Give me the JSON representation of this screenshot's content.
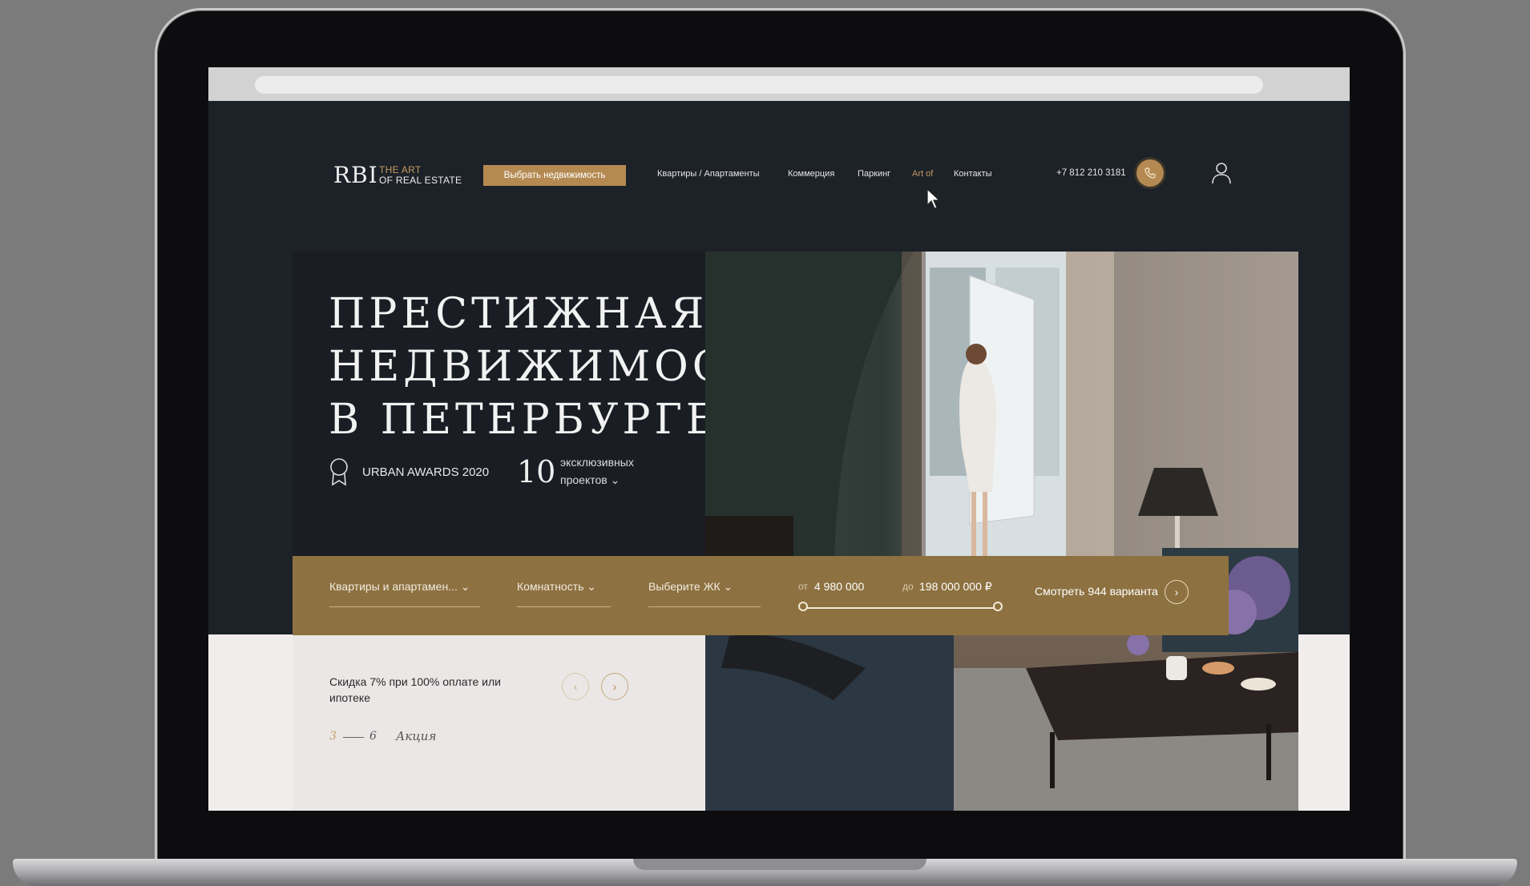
{
  "header": {
    "logo": "RBI",
    "logo_line1": "THE ART",
    "logo_line2": "OF REAL ESTATE",
    "cta": "Выбрать недвижимость",
    "nav": [
      "Квартиры / Апартаменты",
      "Коммерция",
      "Паркинг",
      "Art of",
      "Контакты"
    ],
    "active_nav": "Art of",
    "phone": "+7 812 210 3181"
  },
  "hero": {
    "title_lines": [
      "ПРЕСТИЖНАЯ",
      "НЕДВИЖИМОСТЬ",
      "В ПЕТЕРБУРГЕ"
    ],
    "award": "URBAN AWARDS 2020",
    "projects_count": "10",
    "projects_line1": "эксклюзивных",
    "projects_line2": "проектов ⌄"
  },
  "filter": {
    "type": "Квартиры и апартамен... ⌄",
    "rooms": "Комнатность ⌄",
    "complex": "Выберите ЖК ⌄",
    "price_from_label": "от",
    "price_from": "4 980 000",
    "price_to_label": "до",
    "price_to": "198 000 000 ₽",
    "price_range_fraction": [
      0.0,
      1.0
    ],
    "show_button": "Смотреть 944 варианта",
    "show_arrow": "›"
  },
  "promo": {
    "text": "Скидка 7% при 100% оплате или ипотеке",
    "prev": "‹",
    "next": "›",
    "current": "3",
    "total": "6",
    "tag": "Акция"
  },
  "colors": {
    "dark_bg": "#1d2128",
    "gold": "#b48a52",
    "filter_bg": "#8d7140",
    "promo_bg": "#eae7e6"
  },
  "icons": [
    "award-ribbon-icon",
    "phone-icon",
    "user-icon",
    "cursor-icon",
    "chevron-left-icon",
    "chevron-right-icon"
  ]
}
